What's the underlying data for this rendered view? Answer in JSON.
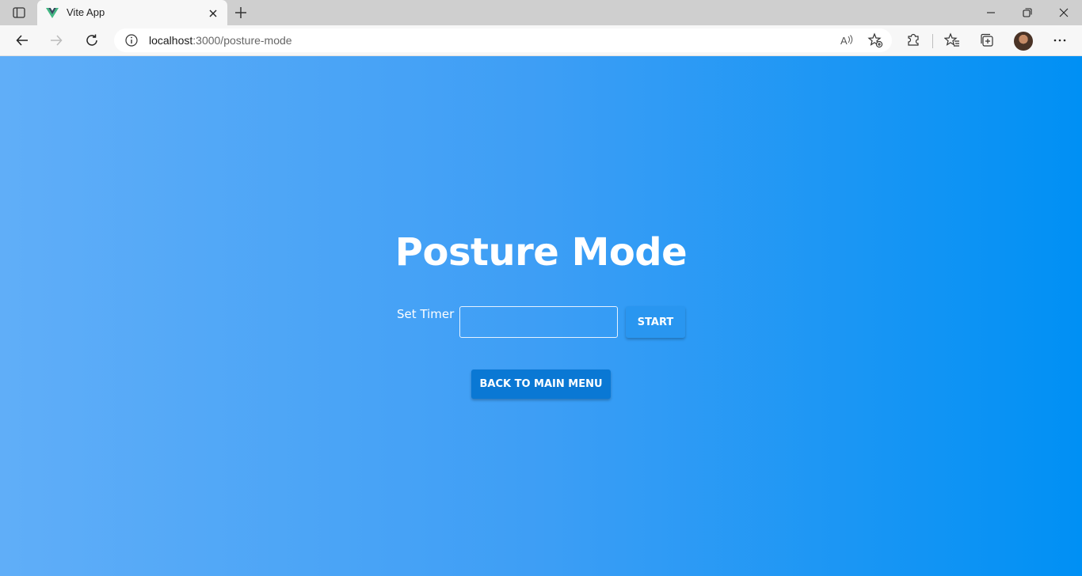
{
  "browser": {
    "tab": {
      "title": "Vite App",
      "favicon": "vue-logo-icon"
    },
    "address": {
      "host": "localhost",
      "path": ":3000/posture-mode"
    },
    "toolbar_icons": [
      "back-icon",
      "forward-icon",
      "refresh-icon",
      "info-icon",
      "read-aloud-icon",
      "add-favorite-icon",
      "extensions-icon",
      "favorites-icon",
      "collections-icon",
      "profile-avatar",
      "more-menu-icon"
    ],
    "window_controls": [
      "minimize-icon",
      "restore-icon",
      "close-icon"
    ]
  },
  "page": {
    "heading": "Posture Mode",
    "timer": {
      "label": "Set Timer",
      "value": "",
      "placeholder": ""
    },
    "start_label": "START",
    "back_label": "BACK TO MAIN MENU"
  },
  "colors": {
    "gradient_start": "#60aef8",
    "gradient_end": "#0090f4",
    "start_button": "#2996f0",
    "back_button": "#0a78d4",
    "vue_green": "#42b883"
  }
}
